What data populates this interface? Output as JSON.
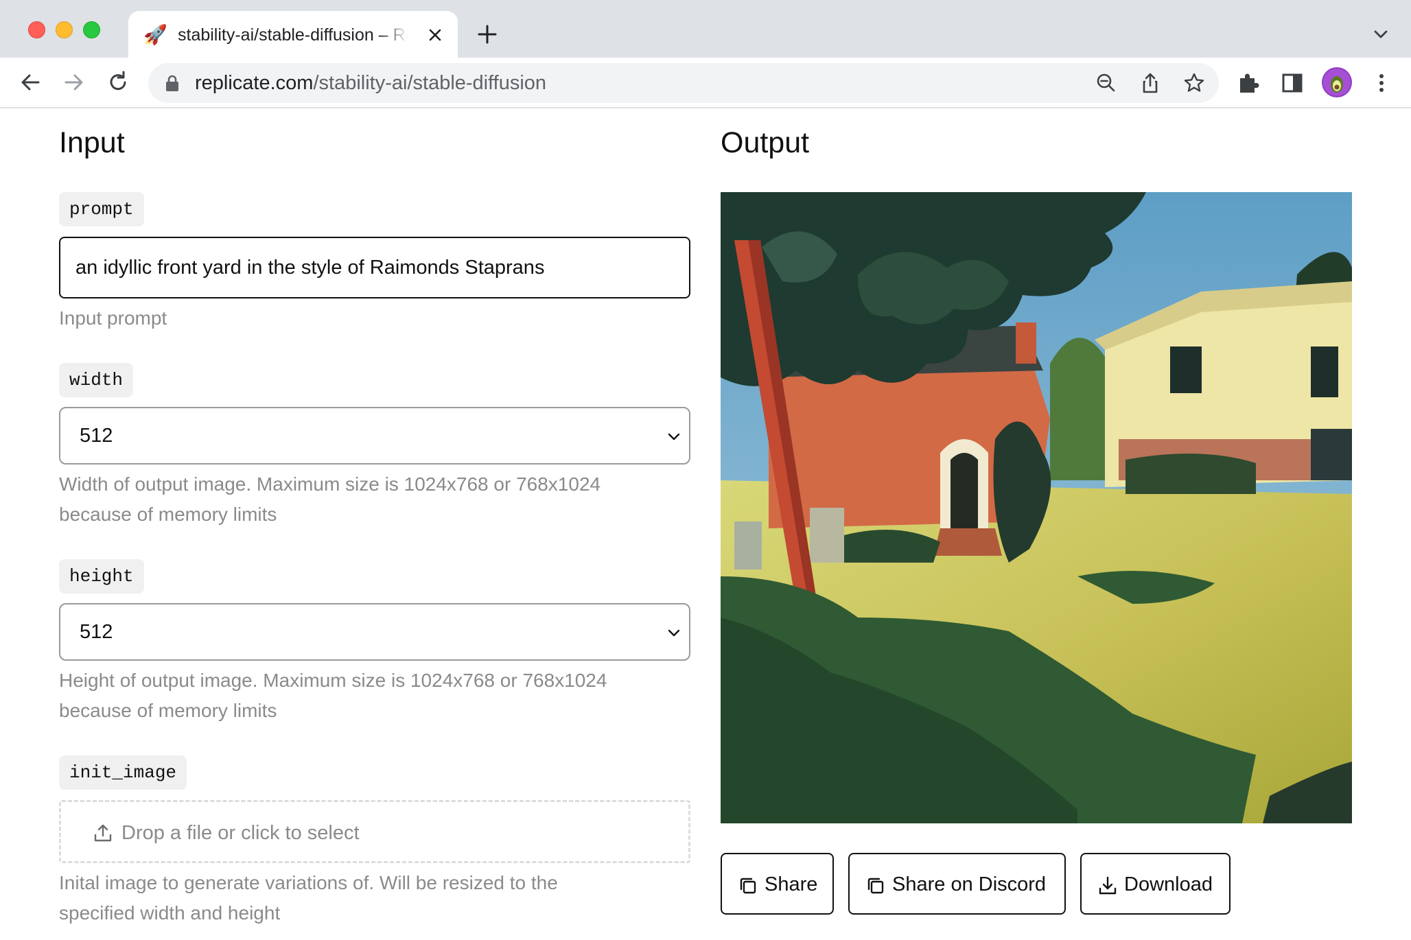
{
  "browser": {
    "tab": {
      "favicon": "rocket-emoji",
      "title": "stability-ai/stable-diffusion – Replicate"
    },
    "url_host": "replicate.com",
    "url_path": "/stability-ai/stable-diffusion",
    "icons": [
      "back-arrow-icon",
      "forward-arrow-icon",
      "reload-icon",
      "lock-icon",
      "zoom-out-icon",
      "share-icon",
      "bookmark-star-icon",
      "extensions-puzzle-icon",
      "side-panel-icon",
      "profile-avatar",
      "kebab-menu-icon",
      "tab-list-chevron-icon"
    ]
  },
  "input": {
    "title": "Input",
    "prompt": {
      "label": "prompt",
      "value": "an idyllic front yard in the style of Raimonds Staprans",
      "help": "Input prompt"
    },
    "width": {
      "label": "width",
      "value": "512",
      "help_line1": "Width of output image. Maximum size is 1024x768 or 768x1024",
      "help_line2": "because of memory limits"
    },
    "height": {
      "label": "height",
      "value": "512",
      "help_line1": "Height of output image. Maximum size is 1024x768 or 768x1024",
      "help_line2": "because of memory limits"
    },
    "init_image": {
      "label": "init_image",
      "dropzone_text": "Drop a file or click to select",
      "help_line1": "Inital image to generate variations of. Will be resized to the",
      "help_line2": "specified width and height"
    }
  },
  "output": {
    "title": "Output",
    "image_alt": "Generated painting of an idyllic front yard",
    "buttons": {
      "share": "Share",
      "share_discord": "Share on Discord",
      "download": "Download"
    }
  },
  "colors": {
    "tabstrip": "#dee1e6",
    "omnibox": "#f1f3f4",
    "label_chip": "#f0f0f0",
    "help_text": "#8a8a8a"
  }
}
